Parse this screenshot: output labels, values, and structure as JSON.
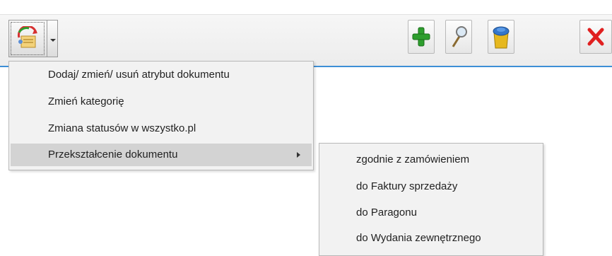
{
  "toolbar": {
    "menu_button_icon": "document-operations-icon",
    "dropdown_icon": "chevron-down-icon",
    "add_icon": "green-plus-icon",
    "search_icon": "magnifier-icon",
    "delete_icon": "trash-bin-icon",
    "close_icon": "red-x-icon"
  },
  "menu": {
    "items": [
      {
        "label": "Dodaj/ zmień/ usuń atrybut dokumentu"
      },
      {
        "label": "Zmień kategorię"
      },
      {
        "label": "Zmiana statusów w wszystko.pl"
      },
      {
        "label": "Przekształcenie dokumentu"
      }
    ]
  },
  "submenu": {
    "items": [
      {
        "label": "zgodnie z zamówieniem"
      },
      {
        "label": "do Faktury sprzedaży"
      },
      {
        "label": "do Paragonu"
      },
      {
        "label": "do Wydania zewnętrznego"
      }
    ]
  },
  "colors": {
    "accent_line": "#3d8fd6",
    "menu_highlight": "#d3d3d3",
    "add_green": "#2e9e2e",
    "close_red": "#e02020"
  }
}
